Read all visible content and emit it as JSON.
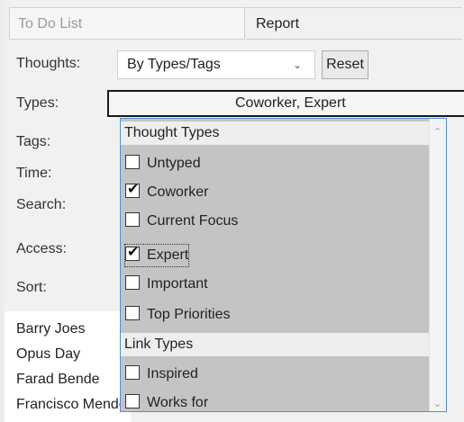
{
  "tabs": {
    "todo": "To Do List",
    "report": "Report"
  },
  "labels": {
    "thoughts": "Thoughts:",
    "types": "Types:",
    "tags": "Tags:",
    "time": "Time:",
    "search": "Search:",
    "access": "Access:",
    "sort": "Sort:"
  },
  "thoughts_select": {
    "value": "By Types/Tags"
  },
  "reset_label": "Reset",
  "types_value": "Coworker, Expert",
  "dropdown": {
    "thought_types_header": "Thought Types",
    "thought_types": [
      {
        "label": "Untyped",
        "checked": false
      },
      {
        "label": "Coworker",
        "checked": true
      },
      {
        "label": "Current Focus",
        "checked": false
      },
      {
        "label": "Expert",
        "checked": true
      },
      {
        "label": "Important",
        "checked": false
      },
      {
        "label": "Top Priorities",
        "checked": false
      }
    ],
    "link_types_header": "Link Types",
    "link_types": [
      {
        "label": "Inspired",
        "checked": false
      },
      {
        "label": "Works for",
        "checked": false
      }
    ]
  },
  "results": [
    "Barry Joes",
    "Opus Day",
    "Farad Bende",
    "Francisco Mendez"
  ]
}
